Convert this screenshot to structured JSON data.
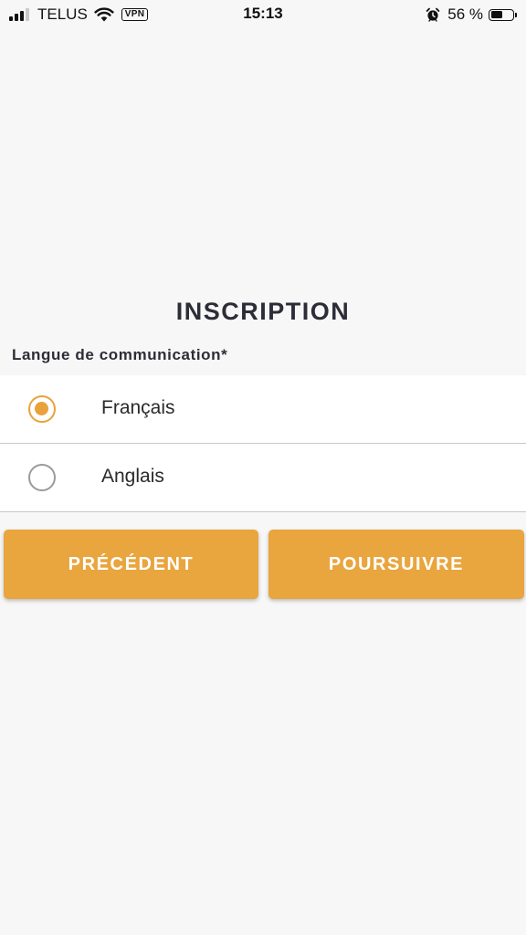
{
  "status_bar": {
    "carrier": "TELUS",
    "vpn": "VPN",
    "time": "15:13",
    "battery_percent": "56 %",
    "battery_level": 0.56,
    "signal_bars": 3,
    "icons": [
      "signal-icon",
      "wifi-icon",
      "vpn-icon",
      "alarm-icon",
      "battery-icon"
    ]
  },
  "page": {
    "title": "INSCRIPTION",
    "section_label": "Langue de communication*"
  },
  "language_options": [
    {
      "label": "Français",
      "selected": true
    },
    {
      "label": "Anglais",
      "selected": false
    }
  ],
  "buttons": {
    "previous": "PRÉCÉDENT",
    "continue": "POURSUIVRE"
  },
  "colors": {
    "accent": "#e9a53e",
    "background": "#f7f7f7",
    "title": "#2d2d37"
  }
}
